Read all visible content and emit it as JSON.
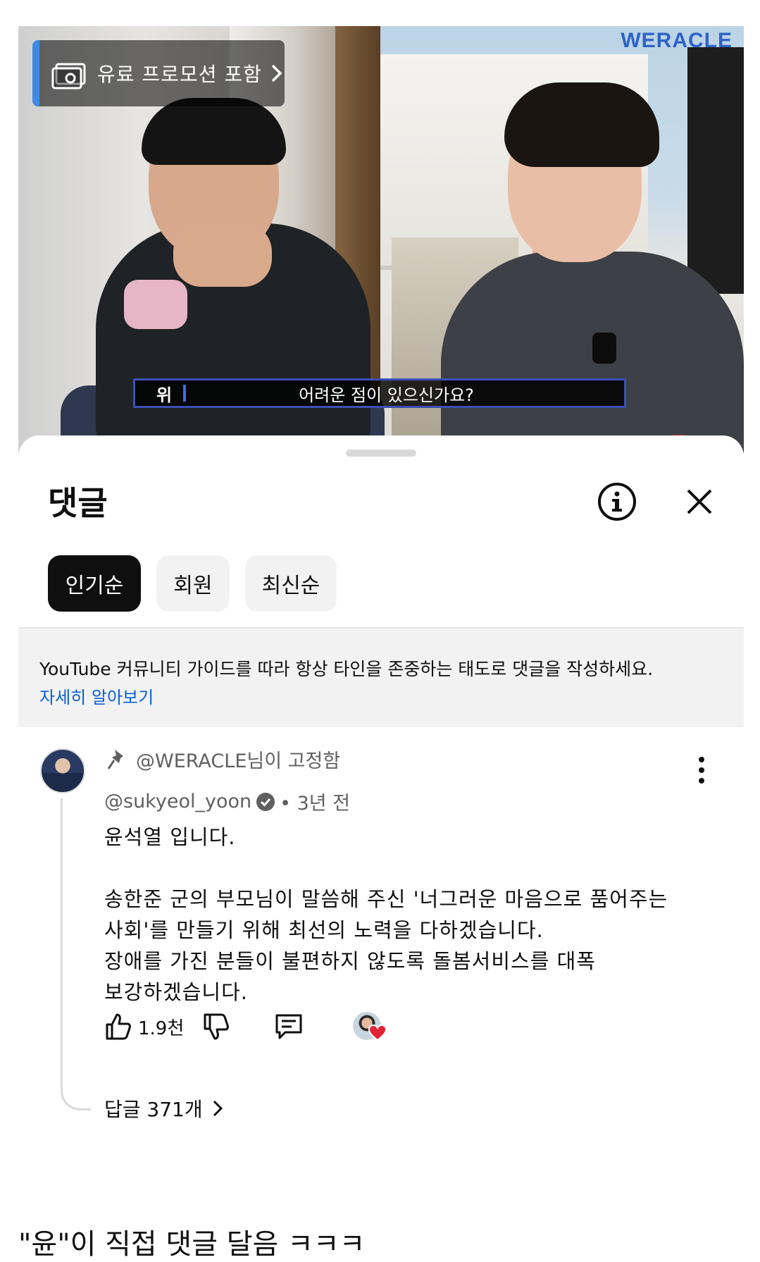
{
  "video": {
    "watermark": "WERACLE",
    "promo_label": "유료 프로모션 포함",
    "subtitle_speaker": "위",
    "subtitle_text": "어려운 점이 있으신가요?"
  },
  "sheet": {
    "title": "댓글",
    "chips": [
      {
        "label": "인기순",
        "active": true
      },
      {
        "label": "회원",
        "active": false
      },
      {
        "label": "최신순",
        "active": false
      }
    ],
    "guide_text": "YouTube 커뮤니티 가이드를 따라 항상 타인을 존중하는 태도로 댓글을 작성하세요.",
    "guide_link": "자세히 알아보기"
  },
  "comment": {
    "pinned_label": "@WERACLE님이 고정함",
    "author": "@sukyeol_yoon",
    "time": "• 3년 전",
    "body_lines": [
      "윤석열 입니다.",
      "",
      "송한준 군의 부모님이 말씀해 주신 '너그러운 마음으로 품어주는",
      "사회'를 만들기 위해 최선의 노력을 다하겠습니다.",
      "장애를 가진 분들이 불편하지 않도록 돌봄서비스를 대폭",
      "보강하겠습니다."
    ],
    "likes": "1.9천",
    "replies_label": "답글 371개"
  },
  "caption": "\"윤\"이 직접 댓글 달음 ㅋㅋㅋ",
  "colors": {
    "link": "#065fd4",
    "chip_active_bg": "#0f0f0f",
    "guide_bg": "#f2f2f2",
    "heart": "#e02434",
    "promo_accent": "#3d8ae6"
  },
  "icons": [
    "promo-ticket-icon",
    "chevron-right-icon",
    "info-icon",
    "close-icon",
    "pin-icon",
    "more-vert-icon",
    "verified-icon",
    "like-icon",
    "dislike-icon",
    "reply-icon",
    "heart-icon"
  ]
}
